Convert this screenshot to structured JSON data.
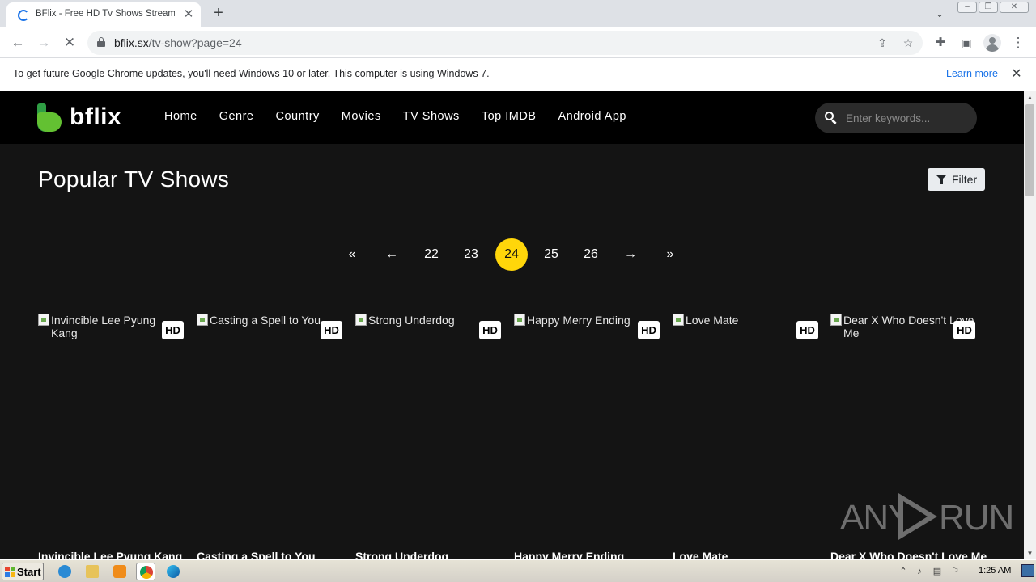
{
  "browser": {
    "tab": {
      "title": "BFlix - Free HD Tv Shows Streaming",
      "close": "✕"
    },
    "new_tab": "+",
    "address": {
      "domain": "bflix.sx",
      "path": "/tv-show?page=24"
    },
    "infobar": {
      "message": "To get future Google Chrome updates, you'll need Windows 10 or later. This computer is using Windows 7.",
      "link": "Learn more",
      "close": "✕"
    }
  },
  "site": {
    "logo": "bflix",
    "nav": [
      "Home",
      "Genre",
      "Country",
      "Movies",
      "TV Shows",
      "Top IMDB",
      "Android App"
    ],
    "search_placeholder": "Enter keywords...",
    "page_title": "Popular TV Shows",
    "filter_label": "Filter",
    "pagination": {
      "first": "«",
      "prev": "←",
      "pages": [
        "22",
        "23",
        "24",
        "25",
        "26"
      ],
      "current": "24",
      "next": "→",
      "last": "»"
    },
    "shows": [
      {
        "title": "Invincible Lee Pyung Kang",
        "alt": "Invincible Lee Pyung Kang",
        "quality": "HD"
      },
      {
        "title": "Casting a Spell to You",
        "alt": "Casting a Spell to You",
        "quality": "HD"
      },
      {
        "title": "Strong Underdog",
        "alt": "Strong Underdog",
        "quality": "HD"
      },
      {
        "title": "Happy Merry Ending",
        "alt": "Happy Merry Ending",
        "quality": "HD"
      },
      {
        "title": "Love Mate",
        "alt": "Love Mate",
        "quality": "HD"
      },
      {
        "title": "Dear X Who Doesn't Love Me",
        "alt": "Dear X Who Doesn't Love Me",
        "quality": "HD"
      }
    ],
    "watermark": {
      "left": "ANY",
      "right": "RUN"
    }
  },
  "taskbar": {
    "start": "Start",
    "clock": "1:25 AM"
  },
  "colors": {
    "page_bg": "#141414",
    "header_bg": "#000000",
    "accent_yellow": "#ffd60a",
    "logo_green": "#63c132"
  }
}
